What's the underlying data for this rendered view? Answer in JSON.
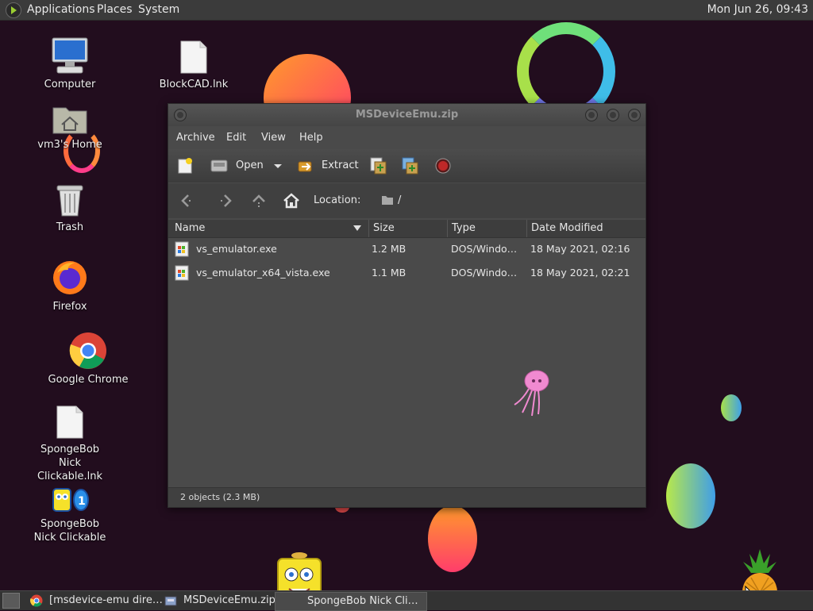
{
  "topbar": {
    "menus": [
      "Applications",
      "Places",
      "System"
    ],
    "clock": "Mon Jun 26, 09:43"
  },
  "desktop": {
    "icons": [
      {
        "label": "Computer",
        "icon": "computer-icon"
      },
      {
        "label": "BlockCAD.lnk",
        "icon": "file-icon"
      },
      {
        "label": "vm3's Home",
        "icon": "home-folder-icon"
      },
      {
        "label": "Trash",
        "icon": "trash-icon"
      },
      {
        "label": "Firefox",
        "icon": "firefox-icon"
      },
      {
        "label": "Google Chrome",
        "icon": "chrome-icon"
      },
      {
        "label": "SpongeBob Nick Clickable.lnk",
        "icon": "file-icon"
      },
      {
        "label": "SpongeBob Nick Clickable",
        "icon": "spongebob-icon"
      }
    ]
  },
  "window": {
    "title": "MSDeviceEmu.zip",
    "menus": [
      "Archive",
      "Edit",
      "View",
      "Help"
    ],
    "toolbar": {
      "open_label": "Open",
      "extract_label": "Extract"
    },
    "location": {
      "label": "Location:",
      "path": "/"
    },
    "columns": [
      "Name",
      "Size",
      "Type",
      "Date Modified"
    ],
    "files": [
      {
        "name": "vs_emulator.exe",
        "size": "1.2 MB",
        "type": "DOS/Windo…",
        "date": "18 May 2021, 02:16"
      },
      {
        "name": "vs_emulator_x64_vista.exe",
        "size": "1.1 MB",
        "type": "DOS/Windo…",
        "date": "18 May 2021, 02:21"
      }
    ],
    "status": "2 objects (2.3 MB)"
  },
  "taskbar": {
    "tasks": [
      {
        "label": "[msdevice-emu dire…",
        "icon": "chrome-icon"
      },
      {
        "label": "MSDeviceEmu.zip",
        "icon": "archive-icon"
      },
      {
        "label": "SpongeBob Nick Cli…",
        "icon": "spongebob-icon"
      }
    ]
  },
  "colors": {
    "desktop_bg": "#220d1e",
    "panel_bg": "#3b3b3b",
    "window_bg": "#4a4a4a"
  }
}
